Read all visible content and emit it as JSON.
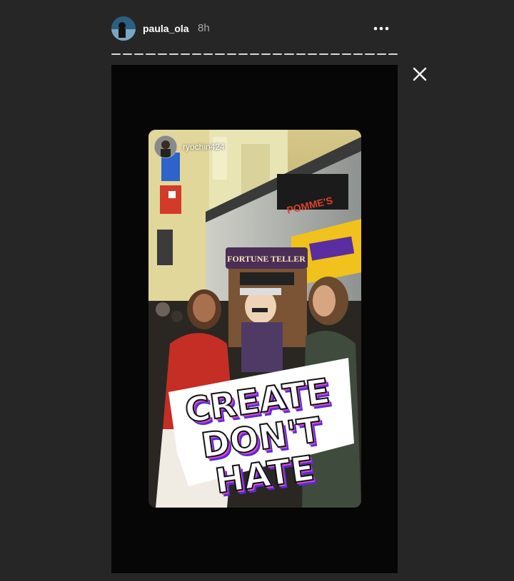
{
  "header": {
    "username": "paula_ola",
    "time": "8h",
    "more_label": "•••"
  },
  "progress": {
    "segments": 25
  },
  "story": {
    "reshare_username": "ryochin424",
    "sign_text": "FORTUNE TELLER",
    "store_text": "POMME'S",
    "sticker": {
      "line1": "CREATE",
      "line2": "DON'T",
      "line3": "HATE"
    }
  },
  "icons": {
    "close": "close-icon",
    "more": "more-options-icon"
  }
}
